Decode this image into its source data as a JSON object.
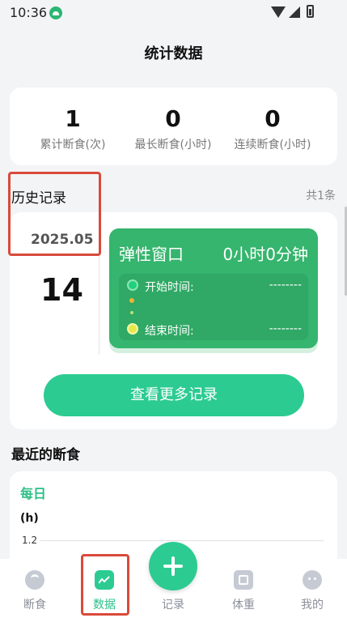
{
  "status_bar": {
    "time": "10:36"
  },
  "header": {
    "title": "统计数据"
  },
  "summary": [
    {
      "value": "1",
      "label": "累计断食(次)"
    },
    {
      "value": "0",
      "label": "最长断食(小时)"
    },
    {
      "value": "0",
      "label": "连续断食(小时)"
    }
  ],
  "history": {
    "title": "历史记录",
    "count": "共1条",
    "month": "2025.05",
    "day": "14",
    "window": {
      "title": "弹性窗口",
      "duration": "0小时0分钟",
      "start_label": "开始时间:",
      "start_value": "--------",
      "end_label": "结束时间:",
      "end_value": "--------"
    },
    "more_button": "查看更多记录"
  },
  "recent": {
    "title": "最近的断食",
    "period": "每日",
    "unit": "(h)",
    "y_tick": "1.2"
  },
  "nav": [
    {
      "label": "断食",
      "icon": "gauge-icon",
      "active": false
    },
    {
      "label": "数据",
      "icon": "chart-icon",
      "active": true
    },
    {
      "label": "记录",
      "icon": "plus-icon",
      "active": false
    },
    {
      "label": "体重",
      "icon": "scale-icon",
      "active": false
    },
    {
      "label": "我的",
      "icon": "profile-icon",
      "active": false
    }
  ],
  "colors": {
    "accent": "#2ccb92",
    "window_green": "#35b56d",
    "highlight": "#d94a3a"
  }
}
